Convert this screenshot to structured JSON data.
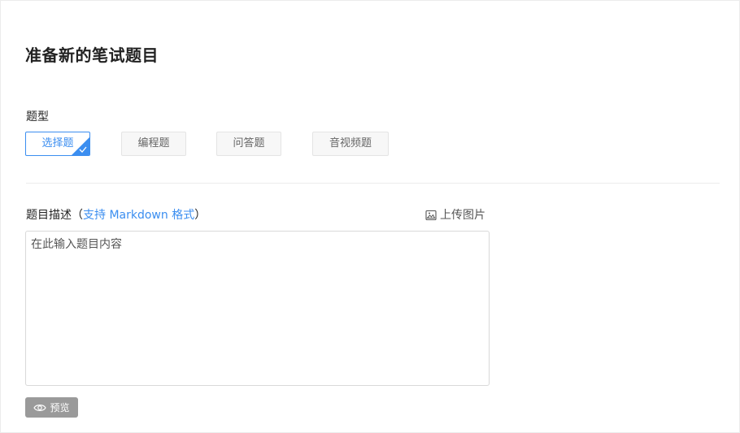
{
  "page": {
    "title": "准备新的笔试题目"
  },
  "question_type": {
    "label": "题型",
    "options": [
      {
        "label": "选择题",
        "selected": true
      },
      {
        "label": "编程题",
        "selected": false
      },
      {
        "label": "问答题",
        "selected": false
      },
      {
        "label": "音视频题",
        "selected": false
      }
    ]
  },
  "description": {
    "label_prefix": "题目描述（",
    "link_text": "支持 Markdown 格式",
    "label_suffix": "）",
    "upload_label": "上传图片",
    "upload_icon": "image-icon",
    "placeholder": "在此输入题目内容",
    "value": ""
  },
  "preview": {
    "label": "预览",
    "icon": "eye-icon"
  },
  "colors": {
    "accent": "#3b8ef0",
    "preview_button_bg": "#9a9a9a"
  }
}
